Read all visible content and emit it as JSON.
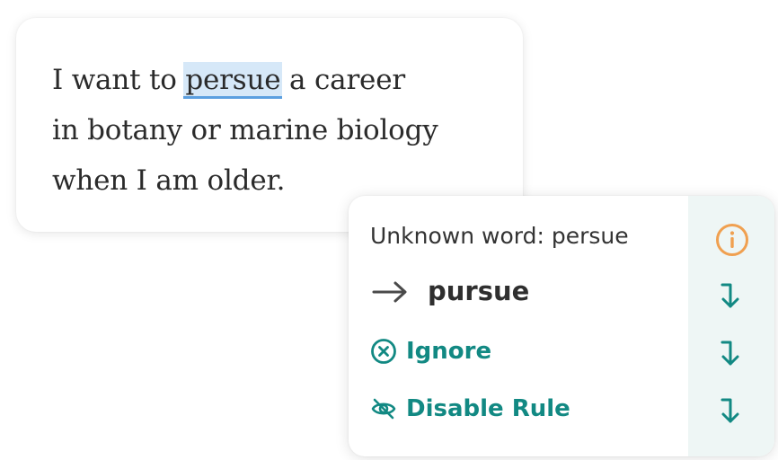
{
  "editor": {
    "line1_before": "I want to ",
    "misspelled_word": "persue",
    "line1_after": " a career",
    "line2": "in botany or marine biology",
    "line3": "when I am older."
  },
  "popup": {
    "title": "Unknown word: persue",
    "suggestion": "pursue",
    "ignore_label": "Ignore",
    "disable_rule_label": "Disable Rule",
    "icons": {
      "info": "info-circle-icon",
      "suggestion_arrow": "arrow-right-icon",
      "ignore": "close-circle-icon",
      "disable": "eye-off-icon",
      "apply": "arrow-turn-down-icon"
    },
    "colors": {
      "accent": "#128983",
      "info": "#f0a050",
      "highlight": "#d6e8f8",
      "underline": "#5b9fe0",
      "side_panel": "#eef6f5"
    }
  }
}
